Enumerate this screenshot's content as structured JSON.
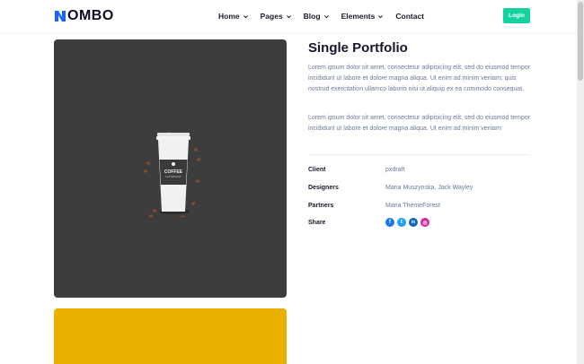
{
  "header": {
    "logo_text": "OMBO",
    "nav": [
      {
        "label": "Home",
        "dropdown": true
      },
      {
        "label": "Pages",
        "dropdown": true
      },
      {
        "label": "Blog",
        "dropdown": true
      },
      {
        "label": "Elements",
        "dropdown": true
      },
      {
        "label": "Contact",
        "dropdown": false
      }
    ],
    "login_label": "Login"
  },
  "media": {
    "cup_label_top": "COFFEE",
    "cup_label_bottom": "CUP MOCKUP"
  },
  "portfolio": {
    "title": "Single Portfolio",
    "paragraph_1": "Lorem ipsum dolor sit amet, consectetur adipisicing elit, sed do eiusmod tempor incididunt ut labore et dolore magna aliqua. Ut enim ad minim veniam, quis nostrud exercitation ullamco laboris nisi ut aliquip ex ea commodo consequat.",
    "paragraph_2": "Lorem ipsum dolor sit amet, consectetur adipisicing elit, sed do eiusmod tempor incididunt ut labore et dolore magna aliqua. Ut enim ad minim veniam",
    "meta": {
      "client_label": "Client",
      "client_value": "pxdraft",
      "designers_label": "Designers",
      "designers_value": "Maria Muszynska, Jack Wayley",
      "partners_label": "Partners",
      "partners_value": "Maria ThemeForest",
      "share_label": "Share"
    },
    "share_icons": [
      {
        "icon": "facebook-icon",
        "glyph": "f",
        "color": "#1877f2"
      },
      {
        "icon": "twitter-icon",
        "glyph": "t",
        "color": "#1da1f2"
      },
      {
        "icon": "linkedin-icon",
        "glyph": "in",
        "color": "#0a66c2"
      },
      {
        "icon": "instagram-icon",
        "glyph": "◎",
        "color": "#d6249f"
      }
    ]
  },
  "colors": {
    "accent": "#14d29f",
    "media_dark": "#3d3d3d",
    "media_yellow": "#e9b000"
  }
}
